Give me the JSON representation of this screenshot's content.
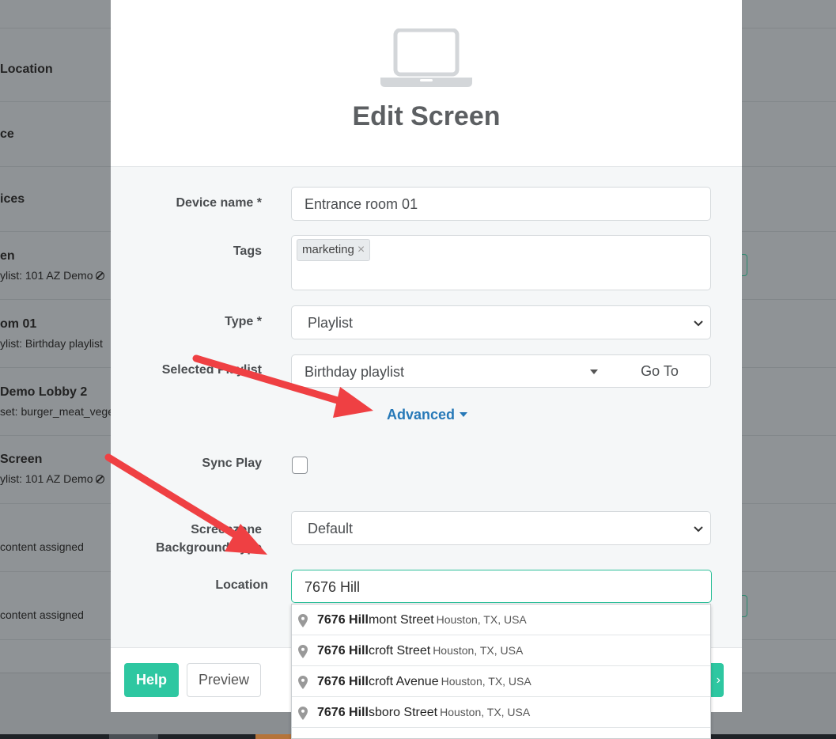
{
  "background_list": {
    "rows": [
      {
        "title": "Location",
        "subtitle": "",
        "ban": false
      },
      {
        "title": "ce",
        "subtitle": "",
        "ban": false
      },
      {
        "title": "ices",
        "subtitle": "",
        "ban": false
      },
      {
        "title": "en",
        "subtitle": "ylist: 101 AZ Demo",
        "ban": true
      },
      {
        "title": "om 01",
        "subtitle": "ylist: Birthday playlist",
        "ban": false
      },
      {
        "title": "Demo Lobby 2",
        "subtitle": "set: burger_meat_veget",
        "ban": false
      },
      {
        "title": "Screen",
        "subtitle": "ylist: 101 AZ Demo",
        "ban": true
      },
      {
        "title": "",
        "subtitle": "content assigned",
        "ban": false
      },
      {
        "title": "",
        "subtitle": "content assigned",
        "ban": false
      }
    ]
  },
  "modal": {
    "icon": "laptop-icon",
    "title": "Edit Screen",
    "device_name_label": "Device name *",
    "device_name_value": "Entrance room 01",
    "tags_label": "Tags",
    "tags": [
      "marketing"
    ],
    "tag_remove_glyph": "×",
    "type_label": "Type *",
    "type_value": "Playlist",
    "selected_playlist_label": "Selected Playlist",
    "selected_playlist_value": "Birthday playlist",
    "go_to_label": "Go To",
    "advanced_label": "Advanced",
    "sync_play_label": "Sync Play",
    "sync_play_checked": false,
    "screenzone_label_line1": "Screenzone",
    "screenzone_label_line2": "Background Type",
    "screenzone_value": "Default",
    "location_label": "Location",
    "location_value": "7676 Hill",
    "help_label": "Help",
    "preview_label": "Preview"
  },
  "autocomplete": [
    {
      "match": "7676 Hill",
      "rest": "mont Street",
      "secondary": "Houston, TX, USA"
    },
    {
      "match": "7676 Hill",
      "rest": "croft Street",
      "secondary": "Houston, TX, USA"
    },
    {
      "match": "7676 Hill",
      "rest": "croft Avenue",
      "secondary": "Houston, TX, USA"
    },
    {
      "match": "7676 Hill",
      "rest": "sboro Street",
      "secondary": "Houston, TX, USA"
    }
  ],
  "colors": {
    "accent": "#2ec7a1",
    "link": "#2779b8",
    "annotation_arrow": "#ef4043"
  }
}
